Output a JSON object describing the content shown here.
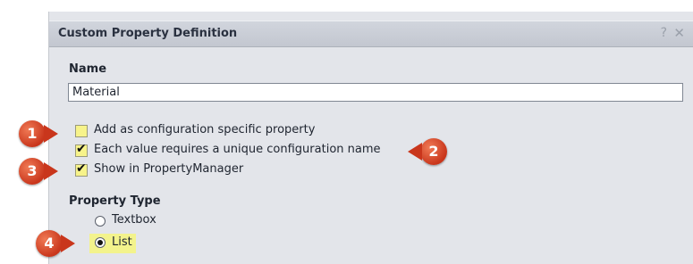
{
  "dialog": {
    "title": "Custom Property Definition",
    "help_icon": "?",
    "close_icon": "✕"
  },
  "name_section": {
    "label": "Name",
    "value": "Material"
  },
  "options": [
    {
      "label": "Add as configuration specific property",
      "checked": false
    },
    {
      "label": "Each value requires a unique configuration name",
      "checked": true
    },
    {
      "label": "Show in PropertyManager",
      "checked": true
    }
  ],
  "property_type": {
    "label": "Property Type",
    "options": [
      {
        "label": "Textbox",
        "selected": false
      },
      {
        "label": "List",
        "selected": true
      }
    ]
  },
  "callouts": [
    "1",
    "2",
    "3",
    "4"
  ],
  "colors": {
    "callout": "#c9361c",
    "highlight": "#f3f38c"
  }
}
